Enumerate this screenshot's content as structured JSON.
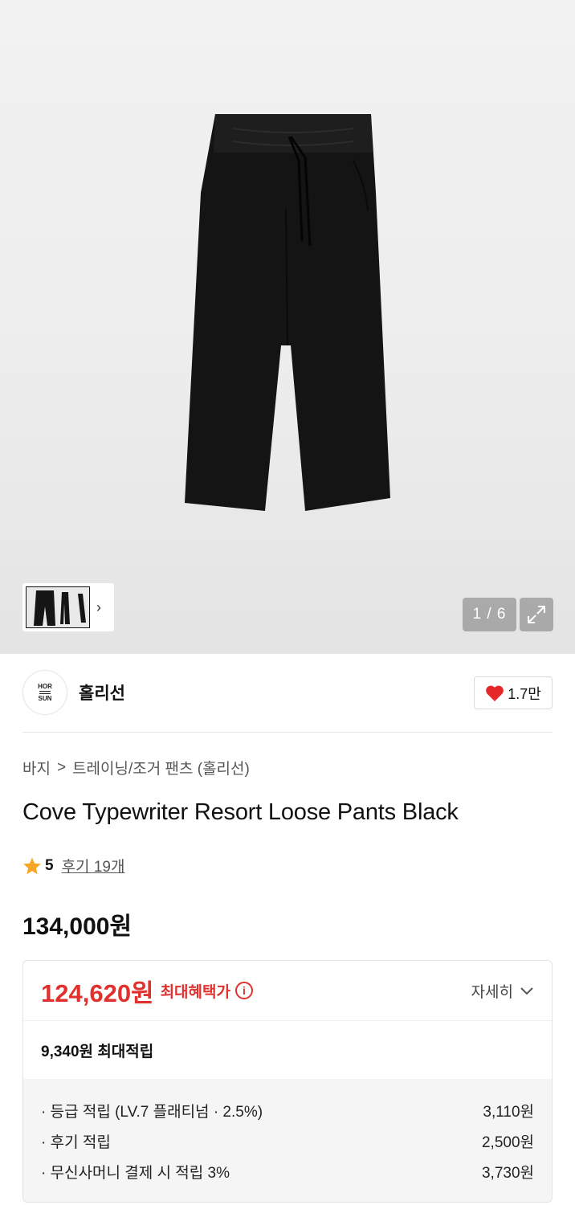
{
  "gallery": {
    "counter": "1 / 6",
    "thumbnail_more_icon": "chevron-right-icon",
    "expand_icon": "expand-icon"
  },
  "brand": {
    "logo_top": "HOR",
    "logo_bottom": "SUN",
    "name": "홀리선",
    "like_count": "1.7만",
    "like_icon": "heart-icon",
    "like_color": "#e52929"
  },
  "breadcrumb": {
    "level1": "바지",
    "separator": ">",
    "level2": "트레이닝/조거 팬츠 (홀리선)"
  },
  "product": {
    "title": "Cove Typewriter Resort Loose Pants Black",
    "rating": "5",
    "reviews": "후기 19개",
    "price": "134,000원"
  },
  "benefit": {
    "sale_price": "124,620원",
    "sale_label": "최대혜택가",
    "info_icon": "i",
    "detail_label": "자세히",
    "accent_color": "#e0312e",
    "points_amount": "9,340원",
    "points_label": "최대적립",
    "items": [
      {
        "label": "· 등급 적립 (LV.7 플래티넘 · 2.5%)",
        "value": "3,110원"
      },
      {
        "label": "· 후기 적립",
        "value": "2,500원"
      },
      {
        "label": "· 무신사머니 결제 시 적립 3%",
        "value": "3,730원"
      }
    ]
  }
}
